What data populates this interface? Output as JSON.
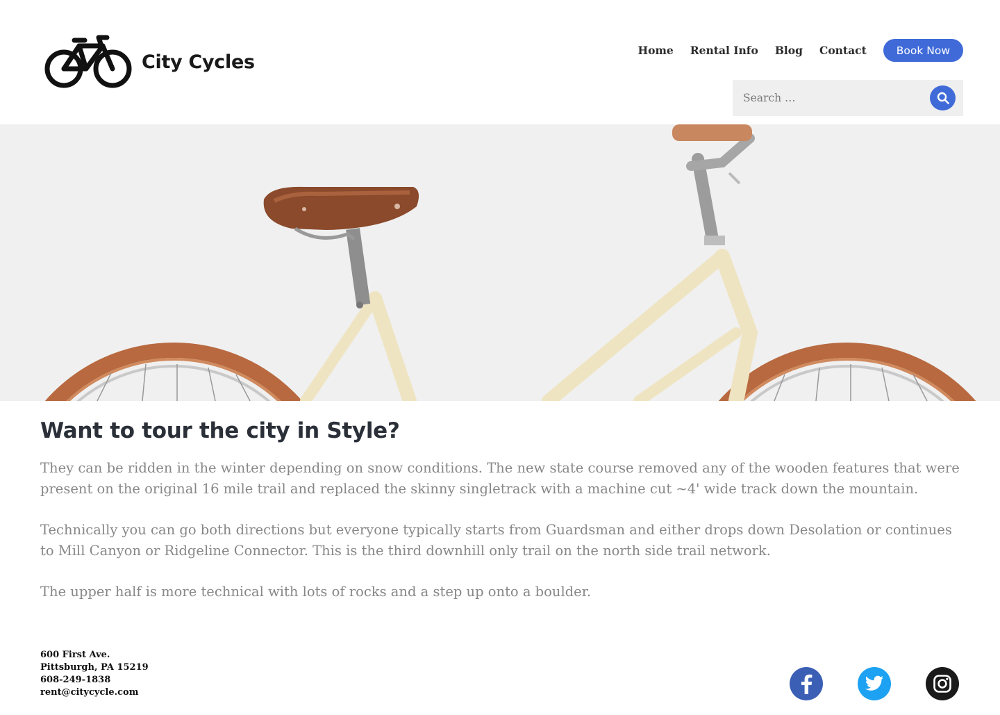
{
  "brand": {
    "name": "City Cycles"
  },
  "nav": {
    "items": [
      {
        "label": "Home"
      },
      {
        "label": "Rental Info"
      },
      {
        "label": "Blog"
      },
      {
        "label": "Contact"
      }
    ],
    "cta_label": "Book Now"
  },
  "search": {
    "placeholder": "Search …"
  },
  "article": {
    "heading": "Want to tour the city in Style?",
    "paragraphs": [
      "They can be ridden in the winter depending on snow conditions. The new state course removed any of the wooden features that were present on the original 16 mile trail and replaced the skinny singletrack with a machine cut ~4' wide track down the mountain.",
      "Technically you can go both directions but everyone typically starts from Guardsman and either drops down Desolation or continues to Mill Canyon or Ridgeline Connector. This is the third downhill only trail on the north side trail network.",
      "The upper half is more technical with lots of rocks and a step up onto a boulder."
    ]
  },
  "footer": {
    "address_line1": "600 First Ave.",
    "address_line2": "Pittsburgh, PA 15219",
    "phone": "608-249-1838",
    "email": "rent@citycycle.com"
  },
  "social": [
    {
      "icon": "facebook-icon",
      "color": "#3b5fb5"
    },
    {
      "icon": "twitter-icon",
      "color": "#1da1f2"
    },
    {
      "icon": "instagram-icon",
      "color": "#1a1a1a"
    }
  ],
  "colors": {
    "accent": "#3f6ad8",
    "heading": "#2a2f38",
    "body_text": "#878787",
    "hero_bg": "#f0f0f0"
  }
}
